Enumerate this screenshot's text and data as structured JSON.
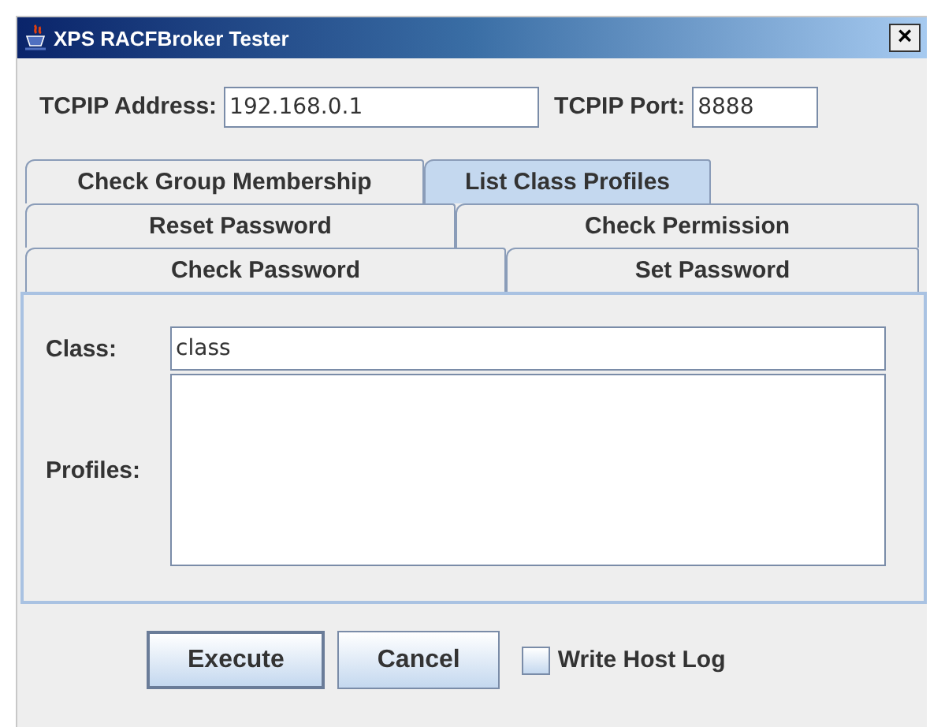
{
  "window": {
    "title": "XPS RACFBroker Tester",
    "close": "×"
  },
  "connection": {
    "address_label": "TCPIP Address:",
    "address": "192.168.0.1",
    "port_label": "TCPIP Port:",
    "port": "8888"
  },
  "tab_rows": [
    {
      "tabs": [
        {
          "label": "Check Group Membership",
          "selected": false
        },
        {
          "label": "List Class Profiles",
          "selected": true
        }
      ]
    },
    {
      "tabs": [
        {
          "label": "Reset Password",
          "selected": false
        },
        {
          "label": "Check Permission",
          "selected": false
        }
      ]
    },
    {
      "tabs": [
        {
          "label": "Check Password",
          "selected": false
        },
        {
          "label": "Set Password",
          "selected": false
        }
      ]
    }
  ],
  "form": {
    "class_label": "Class:",
    "class_value": "class",
    "profiles_label": "Profiles:"
  },
  "buttons": [
    {
      "label": "Execute",
      "kind": "default"
    },
    {
      "label": "Cancel",
      "kind": "normal"
    }
  ],
  "write_host_log": {
    "label": "Write Host Log",
    "checked": false
  }
}
